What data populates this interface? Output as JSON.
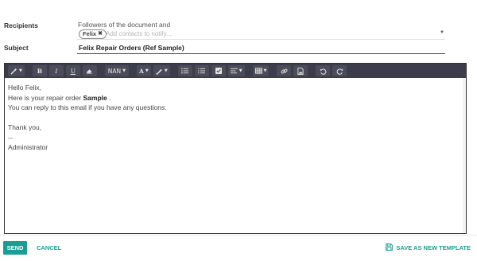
{
  "form": {
    "recipients_label": "Recipients",
    "followers_text": "Followers of the document and",
    "recipient_chip": "Felix",
    "contacts_placeholder": "Add contacts to notify...",
    "subject_label": "Subject",
    "subject_value": "Felix Repair Orders (Ref Sample)"
  },
  "toolbar": {
    "bold": "B",
    "italic": "I",
    "underline": "U",
    "font_size": "NAN",
    "font_color": "A"
  },
  "body": {
    "greeting": "Hello Felix,",
    "line2_prefix": "Here is your repair order ",
    "line2_bold": "Sample",
    "line2_suffix": " .",
    "line3": "You can reply to this email if you have any questions.",
    "closing": "Thank you,",
    "dashes": "--",
    "signature": "Administrator"
  },
  "footer": {
    "send": "SEND",
    "cancel": "CANCEL",
    "save_template": "SAVE AS NEW TEMPLATE"
  },
  "colors": {
    "accent": "#1a9e94",
    "toolbar_bg": "#3b3e4a"
  }
}
